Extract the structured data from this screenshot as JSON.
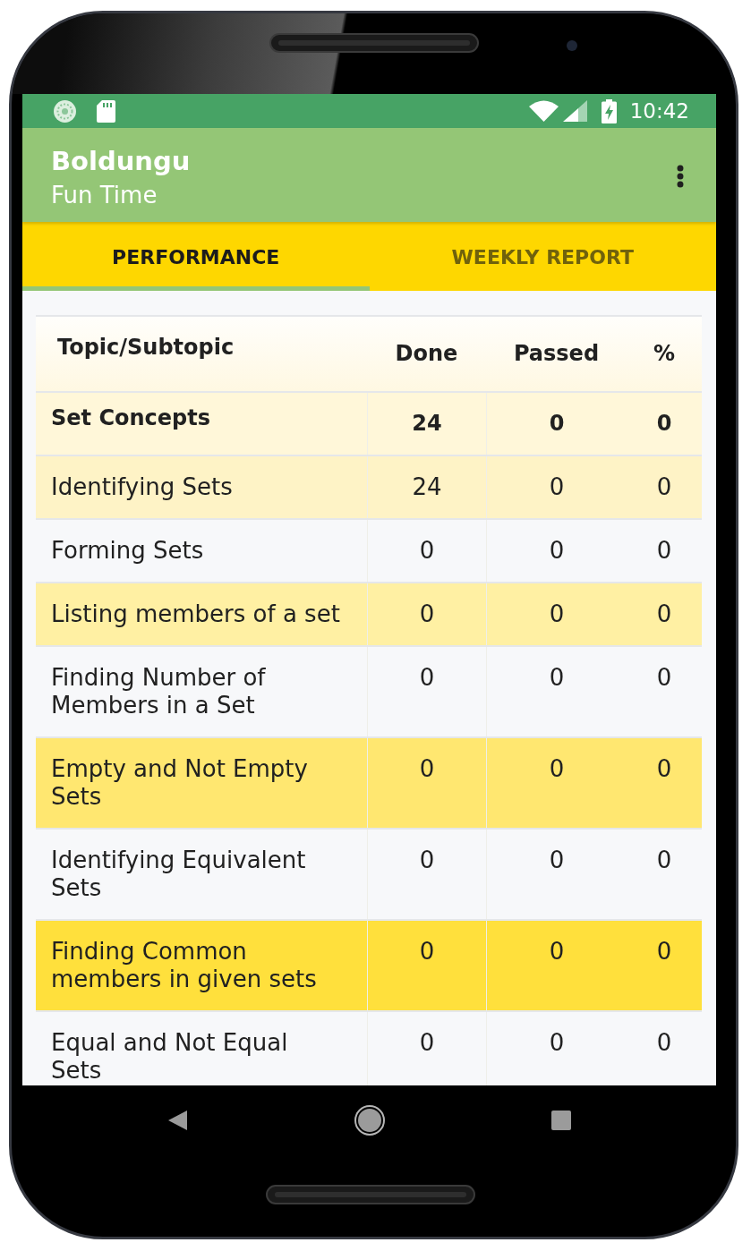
{
  "status_bar": {
    "time": "10:42"
  },
  "app_bar": {
    "title": "Boldungu",
    "subtitle": "Fun Time"
  },
  "tabs": [
    {
      "label": "PERFORMANCE",
      "selected": true
    },
    {
      "label": "WEEKLY REPORT",
      "selected": false
    }
  ],
  "table": {
    "columns": [
      "Topic/Subtopic",
      "Done",
      "Passed",
      "%"
    ],
    "rows": [
      {
        "kind": "topic",
        "topic": "Set Concepts",
        "done": "24",
        "passed": "0",
        "percent": "0",
        "color": "#fff7d9"
      },
      {
        "kind": "subtopic",
        "topic": "Identifying Sets",
        "done": "24",
        "passed": "0",
        "percent": "0",
        "color": "#fef3c6"
      },
      {
        "kind": "subtopic",
        "topic": "Forming Sets",
        "done": "0",
        "passed": "0",
        "percent": "0",
        "color": "#f7f8fa"
      },
      {
        "kind": "subtopic",
        "topic": "Listing members of a set",
        "done": "0",
        "passed": "0",
        "percent": "0",
        "color": "#fff0a3"
      },
      {
        "kind": "subtopic",
        "topic": "Finding Number of Members in a Set",
        "done": "0",
        "passed": "0",
        "percent": "0",
        "color": "#f7f8fa"
      },
      {
        "kind": "subtopic",
        "topic": "Empty and Not Empty Sets",
        "done": "0",
        "passed": "0",
        "percent": "0",
        "color": "#ffe770"
      },
      {
        "kind": "subtopic",
        "topic": "Identifying Equivalent Sets",
        "done": "0",
        "passed": "0",
        "percent": "0",
        "color": "#f7f8fa"
      },
      {
        "kind": "subtopic",
        "topic": "Finding Common members in given sets",
        "done": "0",
        "passed": "0",
        "percent": "0",
        "color": "#ffe03c"
      },
      {
        "kind": "subtopic",
        "topic": "Equal and Not Equal Sets",
        "done": "0",
        "passed": "0",
        "percent": "0",
        "color": "#f7f8fa"
      }
    ]
  }
}
